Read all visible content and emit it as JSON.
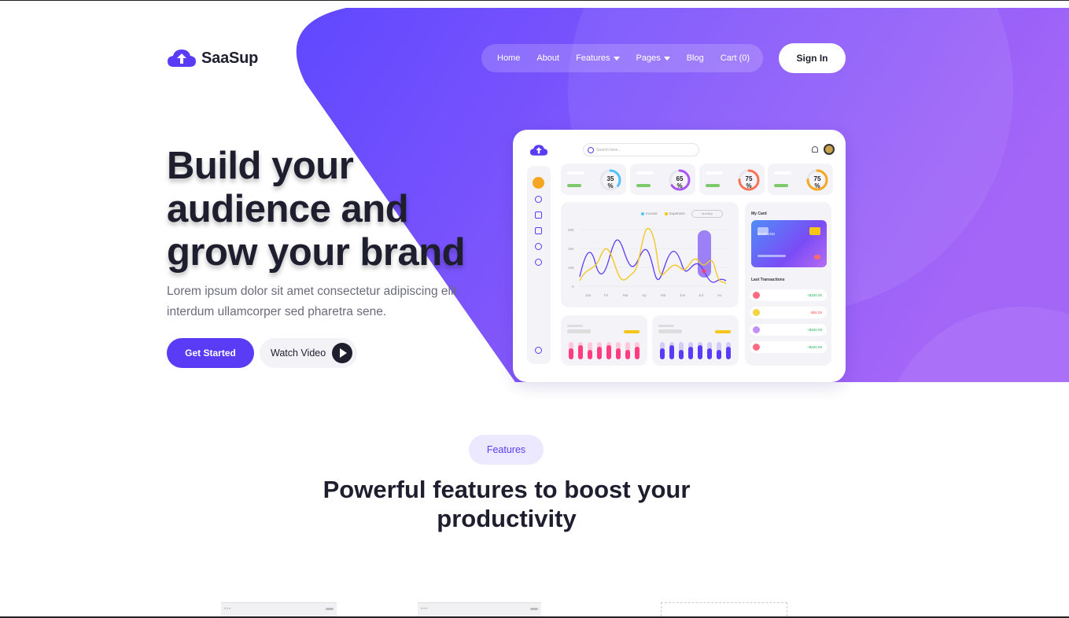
{
  "brand": {
    "name": "SaaSup"
  },
  "nav": {
    "items": [
      {
        "label": "Home"
      },
      {
        "label": "About"
      },
      {
        "label": "Features",
        "has_dropdown": true
      },
      {
        "label": "Pages",
        "has_dropdown": true
      },
      {
        "label": "Blog"
      },
      {
        "label": "Cart (0)"
      }
    ],
    "signin_label": "Sign In"
  },
  "hero": {
    "title": "Build your audience and grow your brand",
    "subtitle": "Lorem ipsum dolor sit amet consectetur adipiscing elit interdum ullamcorper sed pharetra sene.",
    "primary_cta": "Get Started",
    "secondary_cta": "Watch Video"
  },
  "dashboard": {
    "search_placeholder": "Search here...",
    "stats": [
      {
        "value": "35",
        "unit": "%",
        "color": "#4fc3f7"
      },
      {
        "value": "65",
        "unit": "%",
        "color": "#a855f7"
      },
      {
        "value": "75",
        "unit": "%",
        "color": "#f97356"
      },
      {
        "value": "75",
        "unit": "%",
        "color": "#f5a623"
      }
    ],
    "chart": {
      "legend": [
        "Income",
        "Expenses"
      ],
      "select": "Monthly",
      "y_ticks": [
        "20K",
        "15K",
        "10K",
        "0"
      ],
      "x_ticks": [
        "Jan",
        "Fe",
        "Ma",
        "Ap",
        "Ma",
        "Jun",
        "Jul",
        "Au"
      ]
    },
    "card_panel": {
      "title": "My Card",
      "card_amount": "$3.50 USD",
      "transactions_title": "Last Transactions",
      "transactions": [
        {
          "amount": "+$320.00",
          "color": "#ff6b81",
          "sign": "pos"
        },
        {
          "amount": "-$55.00",
          "color": "#f5d442",
          "sign": "neg"
        },
        {
          "amount": "+$320.00",
          "color": "#c48ff7",
          "sign": "pos"
        },
        {
          "amount": "+$320.00",
          "color": "#ff6b81",
          "sign": "pos"
        }
      ]
    }
  },
  "features": {
    "pill": "Features",
    "title": "Powerful features to boost your productivity"
  },
  "colors": {
    "accent": "#5a3cf6",
    "hero_gradient_start": "#6a4cff",
    "hero_gradient_end": "#a266f6"
  }
}
